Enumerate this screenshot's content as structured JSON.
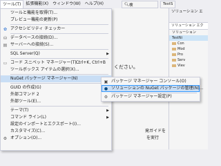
{
  "menubar": {
    "items": [
      "ツール(T)",
      "拡張機能(X)",
      "ウィンドウ(W)",
      "ヘルプ(H)"
    ],
    "search_text": "検",
    "solution_name": "TestS"
  },
  "background": {
    "text1": "ください。",
    "text2": "発ガイドを",
    "text3": "を実行"
  },
  "solution_explorer": {
    "header": "ソリューション エ",
    "search": "ソリューション エク",
    "rows": [
      "ソリューション",
      "TestNi",
      "Con",
      "Mod",
      "Pro",
      "Serv",
      "Viev"
    ]
  },
  "menu": {
    "items": [
      {
        "label": "ツールと機能を取得(T)...",
        "shortcut": "",
        "icon": "",
        "submenu": false
      },
      {
        "label": "プレビュー機能の更新(P)",
        "shortcut": "",
        "icon": "",
        "submenu": false
      },
      {
        "label": "アクセシビリティ チェッカー",
        "shortcut": "",
        "icon": "accessibility-icon",
        "submenu": false
      },
      {
        "label": "データベースの接続(D)...",
        "shortcut": "",
        "icon": "database-connect-icon",
        "submenu": false
      },
      {
        "label": "サーバーへの接続(S)...",
        "shortcut": "",
        "icon": "server-connect-icon",
        "submenu": false
      },
      {
        "label": "SQL Server(Q)",
        "shortcut": "",
        "icon": "",
        "submenu": true
      },
      {
        "label": "コード スニペット マネージャー(T)...",
        "shortcut": "Ctrl+K, Ctrl+B",
        "icon": "snippet-icon",
        "submenu": false
      },
      {
        "label": "ツールボックス アイテムの選択(X)...",
        "shortcut": "",
        "icon": "",
        "submenu": false
      },
      {
        "label": "NuGet パッケージ マネージャー(N)",
        "shortcut": "",
        "icon": "",
        "submenu": true
      },
      {
        "label": "GUID の作成(G)",
        "shortcut": "",
        "icon": "",
        "submenu": false
      },
      {
        "label": "外部コマンド 2",
        "shortcut": "",
        "icon": "",
        "submenu": false
      },
      {
        "label": "外部ツール(E)...",
        "shortcut": "",
        "icon": "",
        "submenu": false
      },
      {
        "label": "テーマ(T)",
        "shortcut": "",
        "icon": "",
        "submenu": true
      },
      {
        "label": "コマンド ライン(L)",
        "shortcut": "",
        "icon": "",
        "submenu": true
      },
      {
        "label": "設定のインポートとエクスポート(I)...",
        "shortcut": "",
        "icon": "",
        "submenu": false
      },
      {
        "label": "カスタマイズ(C)...",
        "shortcut": "",
        "icon": "",
        "submenu": false
      },
      {
        "label": "オプション(O)...",
        "shortcut": "",
        "icon": "gear-icon",
        "submenu": false
      }
    ]
  },
  "submenu": {
    "items": [
      {
        "label": "パッケージ マネージャー コンソール(O)",
        "icon": "console-icon"
      },
      {
        "label": "ソリューションの NuGet パッケージの管理(N)...",
        "icon": "nuget-icon"
      },
      {
        "label": "パッケージ マネージャー設定(P)",
        "icon": "gear-icon"
      }
    ]
  }
}
